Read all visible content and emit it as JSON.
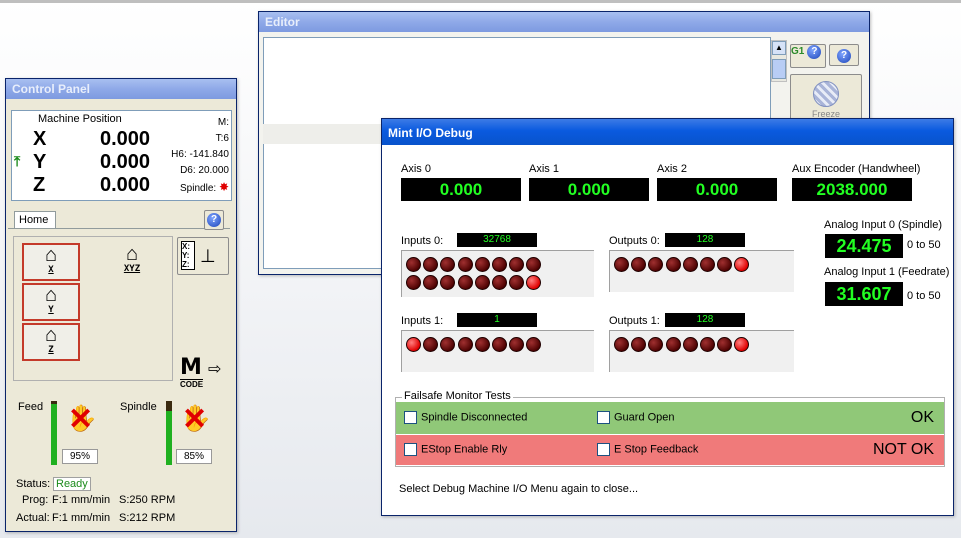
{
  "editor": {
    "title": "Editor",
    "g1_label": "G1",
    "feed_button_label": "Freeze"
  },
  "control_panel": {
    "title": "Control Panel",
    "machine_position_label": "Machine Position",
    "axes": [
      {
        "label": "X",
        "value": "0.000"
      },
      {
        "label": "Y",
        "value": "0.000"
      },
      {
        "label": "Z",
        "value": "0.000"
      }
    ],
    "info": {
      "m": "M:",
      "t": "T:6",
      "h": "H6: -141.840",
      "d": "D6: 20.000",
      "spindle": "Spindle:"
    },
    "home_tab": "Home",
    "home_buttons": {
      "x": "X",
      "y": "Y",
      "z": "Z",
      "xyz": "XYZ"
    },
    "zero_label": "X: Y: Z:",
    "mcode_label": "CODE",
    "mcode_letter": "M",
    "feed_label": "Feed",
    "feed_percent": "95%",
    "feed_fraction": 0.95,
    "spindle_label": "Spindle",
    "spindle_percent": "85%",
    "spindle_fraction": 0.85,
    "status_label": "Status:",
    "status_value": "Ready",
    "prog_label": "Prog:",
    "prog_feed": "F:1 mm/min",
    "prog_speed": "S:250 RPM",
    "actual_label": "Actual:",
    "actual_feed": "F:1 mm/min",
    "actual_speed": "S:212 RPM"
  },
  "debug": {
    "title": "Mint I/O Debug",
    "axes": [
      {
        "label": "Axis 0",
        "value": "0.000"
      },
      {
        "label": "Axis 1",
        "value": "0.000"
      },
      {
        "label": "Axis 2",
        "value": "0.000"
      }
    ],
    "aux": {
      "label": "Aux Encoder (Handwheel)",
      "value": "2038.000"
    },
    "inputs0": {
      "label": "Inputs 0:",
      "value": "32768"
    },
    "outputs0": {
      "label": "Outputs 0:",
      "value": "128"
    },
    "inputs1": {
      "label": "Inputs 1:",
      "value": "1"
    },
    "outputs1": {
      "label": "Outputs 1:",
      "value": "128"
    },
    "analog0": {
      "label": "Analog Input 0 (Spindle)",
      "value": "24.475",
      "range": "0 to 50"
    },
    "analog1": {
      "label": "Analog Input 1 (Feedrate)",
      "value": "31.607",
      "range": "0 to 50"
    },
    "failsafe": {
      "title": "Failsafe Monitor Tests",
      "spindle_disconnected": "Spindle Disconnected",
      "guard_open": "Guard Open",
      "ok": "OK",
      "estop_enable": "EStop Enable Rly",
      "estop_feedback": "E Stop Feedback",
      "not_ok": "NOT OK",
      "ok_color": "#90c878",
      "notok_color": "#f07a7a"
    },
    "footer": "Select Debug Machine I/O Menu again to close...",
    "led_colors": {
      "on": "#e00000",
      "off": "#6a0000"
    }
  }
}
